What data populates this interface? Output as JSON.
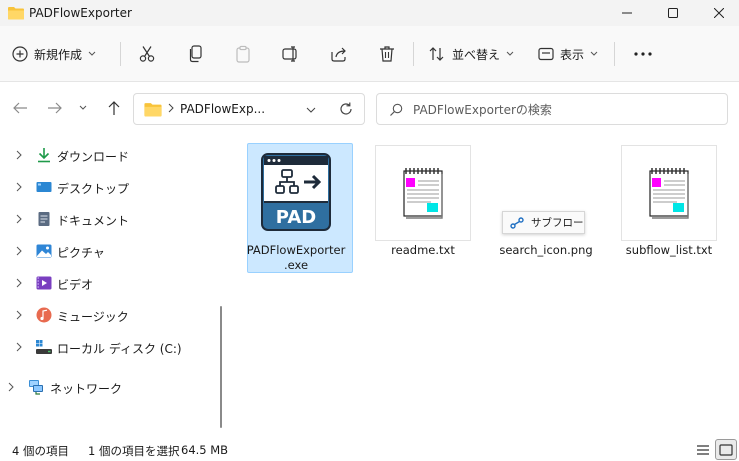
{
  "window": {
    "title": "PADFlowExporter"
  },
  "toolbar": {
    "new_label": "新規作成",
    "sort_label": "並べ替え",
    "view_label": "表示"
  },
  "address": {
    "crumb": "PADFlowExp...",
    "search_placeholder": "PADFlowExporterの検索"
  },
  "sidebar": {
    "items": [
      {
        "label": "ダウンロード",
        "icon": "download-icon"
      },
      {
        "label": "デスクトップ",
        "icon": "desktop-icon"
      },
      {
        "label": "ドキュメント",
        "icon": "documents-icon"
      },
      {
        "label": "ピクチャ",
        "icon": "pictures-icon"
      },
      {
        "label": "ビデオ",
        "icon": "videos-icon"
      },
      {
        "label": "ミュージック",
        "icon": "music-icon"
      },
      {
        "label": "ローカル ディスク (C:)",
        "icon": "local-disk-icon"
      },
      {
        "label": "ネットワーク",
        "icon": "network-icon"
      }
    ]
  },
  "files": [
    {
      "name_line1": "PADFlowExporter",
      "name_line2": ".exe",
      "selected": true,
      "icon": "pad-app-icon",
      "icon_text": "PAD"
    },
    {
      "name": "readme.txt",
      "icon": "text-file-icon"
    },
    {
      "name": "search_icon.png",
      "icon": "flow-icon"
    },
    {
      "name": "subflow_list.txt",
      "icon": "text-file-icon"
    }
  ],
  "tooltip": {
    "label": "サブフロー"
  },
  "status": {
    "item_count": "4 個の項目",
    "selected": "1 個の項目を選択",
    "size": "64.5 MB"
  },
  "colors": {
    "accent": "#0067c0",
    "selection_bg": "#cce8ff",
    "pad_blue": "#2f6fa0",
    "folder_yellow": "#f8c33a"
  }
}
